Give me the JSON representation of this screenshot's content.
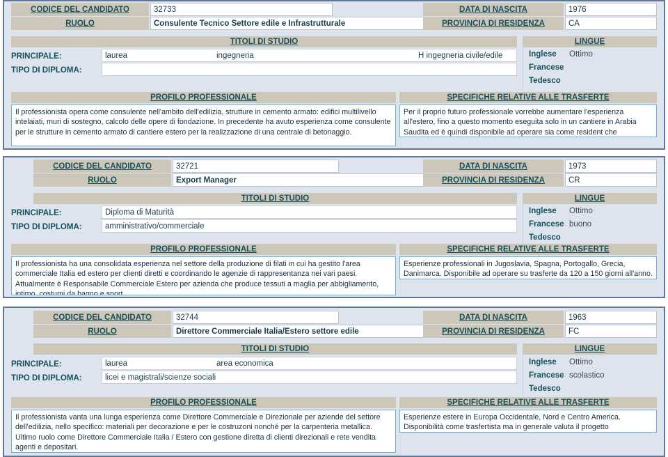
{
  "labels": {
    "codice": "CODICE DEL CANDIDATO",
    "ruolo": "RUOLO",
    "data_nascita": "DATA DI NASCITA",
    "provincia": "PROVINCIA DI RESIDENZA",
    "titoli": "TITOLI DI STUDIO",
    "lingue": "LINGUE",
    "principale": "PRINCIPALE:",
    "tipo_diploma": "TIPO DI DIPLOMA:",
    "profilo": "PROFILO PROFESSIONALE",
    "specifiche": "SPECIFICHE RELATIVE ALLE TRASFERTE",
    "lingua_inglese": "Inglese",
    "lingua_francese": "Francese",
    "lingua_tedesco": "Tedesco"
  },
  "colors": {
    "label_text": "#16505c",
    "beige": "#cdc7b9",
    "card_bg": "#dde4ee",
    "card_border": "#5f7695",
    "textbox_border": "#6ab4cf"
  },
  "records": [
    {
      "codice": "32733",
      "ruolo": "Consulente Tecnico Settore edile e Infrastrutturale",
      "data_nascita": "1976",
      "provincia": "CA",
      "titolo_principale": "laurea",
      "titolo_area": "ingegneria",
      "titolo_dettaglio": "H ingegneria civile/edile",
      "tipo_diploma": "",
      "lingue": [
        {
          "nome": "Inglese",
          "livello": "Ottimo"
        },
        {
          "nome": "Francese",
          "livello": ""
        },
        {
          "nome": "Tedesco",
          "livello": ""
        }
      ],
      "profilo": "Il professionista opera come consulente nell'ambito dell'edilizia, strutture in cemento armato: edifici multilivello intelaiati, muri di sostegno, calcolo delle opere di fondazione. In precedente ha avuto esperienza come  consulente per le strutture in cemento armato di cantiere estero per la realizzazione di una centrale di betonaggio.",
      "specifiche": "Per il proprio futuro professionale vorrebbe aumentare l'esperienza all'estero, fino a questo momento eseguita solo in un cantiere in Arabia Saudita ed è quindi disponibile ad operare sia come resident che trasfertista."
    },
    {
      "codice": "32721",
      "ruolo": "Export Manager",
      "data_nascita": "1973",
      "provincia": "CR",
      "titolo_principale": "Diploma di Maturità",
      "titolo_area": "",
      "titolo_dettaglio": "",
      "tipo_diploma": "amministrativo/commerciale",
      "lingue": [
        {
          "nome": "Inglese",
          "livello": "Ottimo"
        },
        {
          "nome": "Francese",
          "livello": "buono"
        },
        {
          "nome": "Tedesco",
          "livello": ""
        }
      ],
      "profilo": "Il professionista ha una consolidata esperienza nel settore della produzione di filati in cui ha gestito l'area commerciale Italia ed estero per clienti diretti e coordinando le agenzie di rappresentanza nei vari paesi. Attualmente è Responsabile Commerciale Estero per azienda che produce tessuti a maglia per abbigliamento, intimo, costumi da bagno e sport.",
      "specifiche": "Esperienze professionali in Jugoslavia, Spagna, Portogallo, Grecia, Danimarca. Disponibile ad operare su trasferte da 120 a 150 giorni all'anno."
    },
    {
      "codice": "32744",
      "ruolo": "Direttore Commerciale Italia/Estero settore edile",
      "data_nascita": "1963",
      "provincia": "FC",
      "titolo_principale": "laurea",
      "titolo_area": "area economica",
      "titolo_dettaglio": "",
      "tipo_diploma": "licei e magistrali/scienze sociali",
      "lingue": [
        {
          "nome": "Inglese",
          "livello": "Ottimo"
        },
        {
          "nome": "Francese",
          "livello": "scolastico"
        },
        {
          "nome": "Tedesco",
          "livello": ""
        }
      ],
      "profilo": "Il professionista vanta una lunga esperienza come Direttore Commerciale e Direzionale per aziende del settore dell'edilizia, nello specifico: materiali per decorazione e per le costruzoni nonché per la carpenteria metallica. Ultimo ruolo come Direttore Commerciale Italia / Estero con gestione diretta di clienti direzionali e rete vendita agenti e depositari.",
      "specifiche": "Esperienze estere in Europa Occidentale, Nord e Centro America. Disponibilità come trasfertista ma in generale valuta il progetto professionale."
    }
  ]
}
